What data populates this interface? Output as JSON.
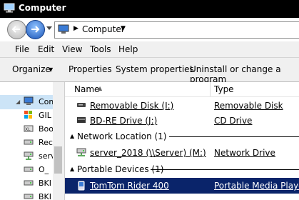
{
  "window": {
    "title": "Computer"
  },
  "address": {
    "location": "Computer"
  },
  "menu": {
    "items": [
      "File",
      "Edit",
      "View",
      "Tools",
      "Help"
    ]
  },
  "commands": {
    "organize": "Organize",
    "properties": "Properties",
    "system_properties": "System properties",
    "uninstall": "Uninstall or change a program"
  },
  "nav": {
    "items": [
      {
        "label": "Comp",
        "icon": "computer-icon",
        "selected": true
      },
      {
        "label": "GIL",
        "icon": "drive-c-icon"
      },
      {
        "label": "Boo",
        "icon": "drive-icon"
      },
      {
        "label": "Rec",
        "icon": "drive-icon"
      },
      {
        "label": "serv",
        "icon": "network-drive-icon"
      },
      {
        "label": "O_",
        "icon": "drive-icon"
      },
      {
        "label": "BKI",
        "icon": "drive-icon"
      },
      {
        "label": "BKI",
        "icon": "drive-icon"
      }
    ]
  },
  "columns": {
    "name": "Name",
    "type": "Type"
  },
  "rows": [
    {
      "name": "Removable Disk (I:)",
      "type": "Removable Disk",
      "icon": "removable-disk-icon"
    },
    {
      "name": "BD-RE Drive (J:)",
      "type": "CD Drive",
      "icon": "optical-drive-icon"
    }
  ],
  "groups": {
    "network": {
      "label": "Network Location (1)"
    },
    "portable": {
      "label": "Portable Devices (1)"
    }
  },
  "network_rows": [
    {
      "name": "server_2018 (\\\\Server) (M:)",
      "type": "Network Drive",
      "icon": "network-drive-icon"
    }
  ],
  "portable_rows": [
    {
      "name": "TomTom Rider 400",
      "type": "Portable Media Player",
      "icon": "media-player-icon",
      "selected": true
    }
  ]
}
